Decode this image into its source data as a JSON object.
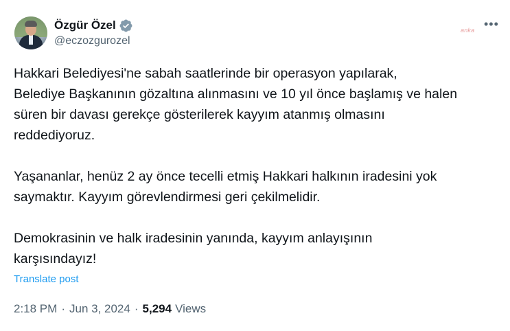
{
  "author": {
    "display_name": "Özgür Özel",
    "handle": "@eczozgurozel",
    "verified_icon": "verified-badge-icon",
    "badge_color": "#829aab"
  },
  "watermark": "anka",
  "more_label": "•••",
  "post": {
    "lines_p1": [
      "Hakkari Belediyesi'ne sabah saatlerinde bir operasyon yapılarak,",
      "Belediye Başkanının gözaltına alınmasını ve 10 yıl önce başlamış ve halen",
      "süren bir davası gerekçe gösterilerek kayyım atanmış olmasını",
      "reddediyoruz."
    ],
    "lines_p2": [
      "Yaşananlar, henüz 2 ay önce tecelli etmiş Hakkari halkının iradesini yok",
      "saymaktır. Kayyım görevlendirmesi geri çekilmelidir."
    ],
    "lines_p3": [
      "Demokrasinin ve halk iradesinin yanında, kayyım anlayışının",
      "karşısındayız!"
    ]
  },
  "translate_label": "Translate post",
  "meta": {
    "time": "2:18 PM",
    "separator": "·",
    "date": "Jun 3, 2024",
    "views_count": "5,294",
    "views_label": "Views"
  },
  "colors": {
    "text": "#0f1419",
    "secondary": "#536471",
    "link": "#1d9bf0"
  }
}
